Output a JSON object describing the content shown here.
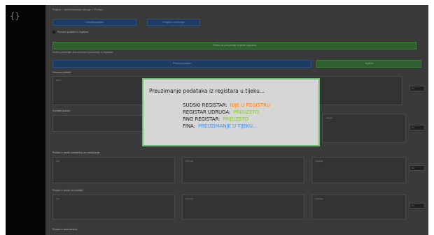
{
  "sidebar": {
    "brace": "{}"
  },
  "header": {
    "breadcrumb": "Prijava > Administracija udruge > Podaci"
  },
  "top_buttons": [
    "Dohvati podatke",
    "Pregled i uređivanje"
  ],
  "option_text": "Preuzmi podatke iz registara",
  "warning_bar": "Podaci se preuzimaju iz javnih registara",
  "warning_text": "Molimo pričekajte dok se podaci preuzimaju iz registara",
  "big_buttons": {
    "left": "Preuzmi podatke",
    "right": "Spremi"
  },
  "sections": [
    {
      "title": "Osnovni podaci",
      "fields": [
        "Naziv"
      ]
    },
    {
      "title": "Kontakt podaci",
      "fields": [
        "Adresa"
      ]
    },
    {
      "title": "Podaci o osobi ovlaštenoj za zastupanje",
      "fields": [
        "Ime",
        "Prezime",
        "Funkcija"
      ]
    },
    {
      "title": "Podaci o osobi za kontakt",
      "fields": [
        "Ime",
        "Prezime",
        "Funkcija"
      ]
    },
    {
      "title": "Podaci o osnivačima"
    }
  ],
  "side_values": [
    "01",
    "01",
    "01",
    "01"
  ],
  "modal": {
    "title": "Preuzimanje podataka iz registara u tijeku...",
    "registers": [
      {
        "name": "SUDSKI REGISTAR:",
        "status": "NIJE U REGISTRU",
        "color": "#f5891f"
      },
      {
        "name": "REGISTAR UDRUGA:",
        "status": "PREUZETO",
        "color": "#8cc63f"
      },
      {
        "name": "RNO REGISTAR:",
        "status": "PREUZETO",
        "color": "#8cc63f"
      },
      {
        "name": "FINA:",
        "status": "PREUZIMANJE U TIJEKU...",
        "color": "#4a90d9"
      }
    ]
  }
}
